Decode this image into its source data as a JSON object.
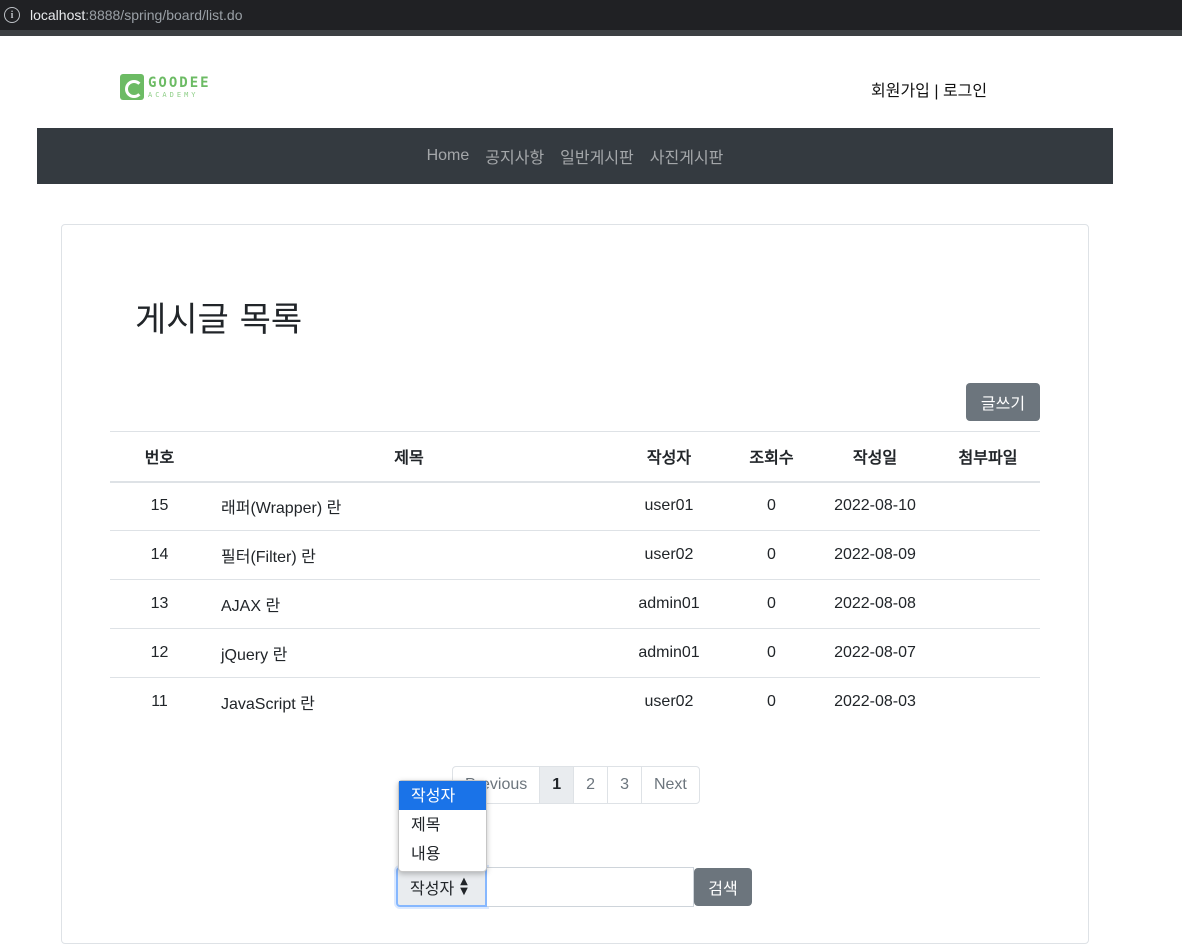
{
  "browser": {
    "url_host": "localhost",
    "url_rest": ":8888/spring/board/list.do"
  },
  "header": {
    "logo_top": "GOODEE",
    "logo_bottom": "ACADEMY",
    "signup": "회원가입",
    "separator": " | ",
    "login": "로그인"
  },
  "nav": {
    "items": [
      "Home",
      "공지사항",
      "일반게시판",
      "사진게시판"
    ]
  },
  "main": {
    "title": "게시글 목록",
    "write_button": "글쓰기"
  },
  "table": {
    "headers": [
      "번호",
      "제목",
      "작성자",
      "조회수",
      "작성일",
      "첨부파일"
    ],
    "rows": [
      {
        "no": "15",
        "title": "래퍼(Wrapper) 란",
        "writer": "user01",
        "views": "0",
        "date": "2022-08-10",
        "file": ""
      },
      {
        "no": "14",
        "title": "필터(Filter) 란",
        "writer": "user02",
        "views": "0",
        "date": "2022-08-09",
        "file": ""
      },
      {
        "no": "13",
        "title": "AJAX 란",
        "writer": "admin01",
        "views": "0",
        "date": "2022-08-08",
        "file": ""
      },
      {
        "no": "12",
        "title": "jQuery 란",
        "writer": "admin01",
        "views": "0",
        "date": "2022-08-07",
        "file": ""
      },
      {
        "no": "11",
        "title": "JavaScript 란",
        "writer": "user02",
        "views": "0",
        "date": "2022-08-03",
        "file": ""
      }
    ]
  },
  "pagination": {
    "previous": "Previous",
    "pages": [
      "1",
      "2",
      "3"
    ],
    "current": "1",
    "next": "Next"
  },
  "search": {
    "options": [
      "작성자",
      "제목",
      "내용"
    ],
    "selected": "작성자",
    "value": "",
    "button": "검색"
  }
}
